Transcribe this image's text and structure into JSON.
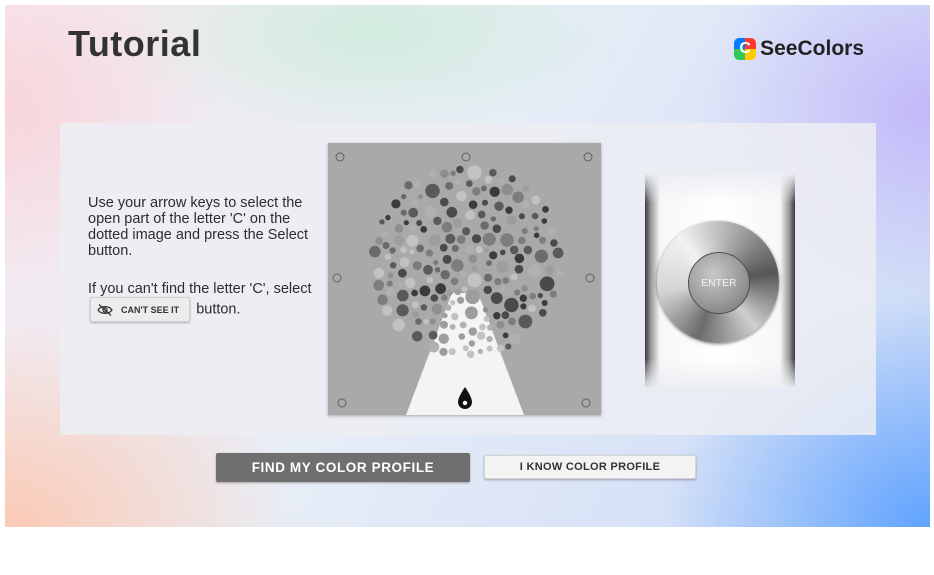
{
  "header": {
    "title": "Tutorial",
    "brand_name": "SeeColors",
    "brand_logo_letter": "C",
    "brand_logo_colors": [
      "#ff3b30",
      "#ffcc00",
      "#34c759",
      "#007aff"
    ]
  },
  "instructions": {
    "paragraph1": "Use your arrow keys to select the open part of the letter 'C' on the dotted image and press the Select button.",
    "paragraph2_before": "If you can't find the letter 'C', select",
    "cant_see_button_label": "CAN'T SEE IT",
    "cant_see_button_icon": "eye-slash-icon",
    "paragraph2_after": "button."
  },
  "test_image": {
    "background": "#a9a9a9",
    "cursor_icon": "drop-pointer-icon"
  },
  "remote": {
    "enter_label": "ENTER"
  },
  "actions": {
    "primary_label": "FIND MY COLOR PROFILE",
    "secondary_label": "I KNOW COLOR PROFILE"
  }
}
